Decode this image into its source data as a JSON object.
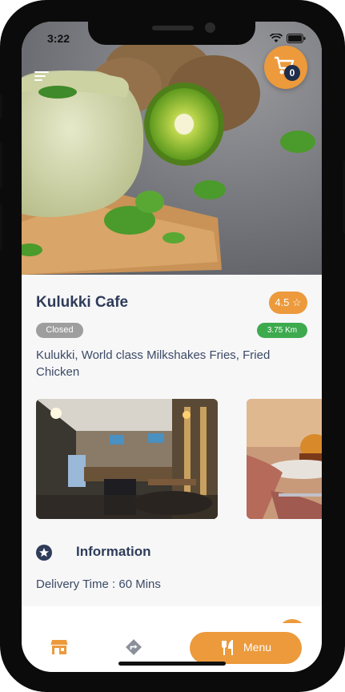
{
  "status_bar": {
    "time": "3:22"
  },
  "cart": {
    "count": "0"
  },
  "restaurant": {
    "name": "Kulukki Cafe",
    "rating": "4.5",
    "status": "Closed",
    "distance": "3.75 Km",
    "description": "Kulukki,  World class Milkshakes Fries, Fried Chicken"
  },
  "information": {
    "title": "Information",
    "delivery_time": "Delivery Time : 60 Mins"
  },
  "bottom_nav": {
    "menu_label": "Menu"
  },
  "colors": {
    "accent": "#ec9a3c",
    "heading": "#2f3c5a",
    "open_green": "#3daa4e",
    "closed_gray": "#9e9e9e"
  }
}
